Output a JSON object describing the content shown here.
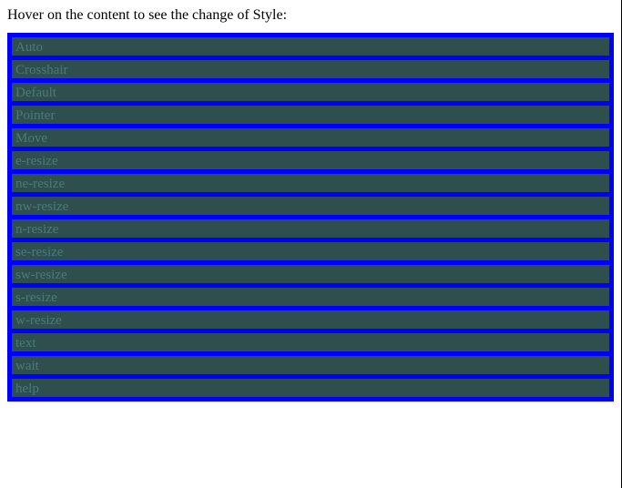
{
  "heading": "Hover on the content to see the change of Style:",
  "items": [
    {
      "label": "Auto",
      "cursor": "auto"
    },
    {
      "label": "Crosshair",
      "cursor": "crosshair"
    },
    {
      "label": "Default",
      "cursor": "default"
    },
    {
      "label": "Pointer",
      "cursor": "pointer"
    },
    {
      "label": "Move",
      "cursor": "move"
    },
    {
      "label": "e-resize",
      "cursor": "e-resize"
    },
    {
      "label": "ne-resize",
      "cursor": "ne-resize"
    },
    {
      "label": "nw-resize",
      "cursor": "nw-resize"
    },
    {
      "label": "n-resize",
      "cursor": "n-resize"
    },
    {
      "label": "se-resize",
      "cursor": "se-resize"
    },
    {
      "label": "sw-resize",
      "cursor": "sw-resize"
    },
    {
      "label": "s-resize",
      "cursor": "s-resize"
    },
    {
      "label": "w-resize",
      "cursor": "w-resize"
    },
    {
      "label": "text",
      "cursor": "text"
    },
    {
      "label": "wait",
      "cursor": "wait"
    },
    {
      "label": "help",
      "cursor": "help"
    }
  ]
}
